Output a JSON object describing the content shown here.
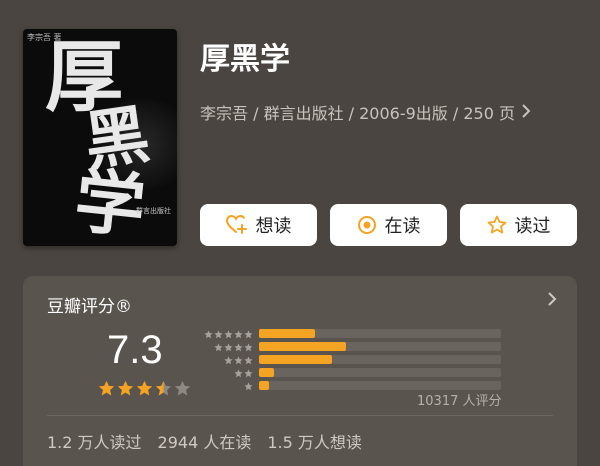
{
  "book": {
    "title": "厚黑学",
    "meta": "李宗吾 / 群言出版社 / 2006-9出版 / 250 页",
    "cover": {
      "glyph1": "厚",
      "glyph2": "黑",
      "glyph3": "学",
      "top_text": "李宗吾 著",
      "seal_text": "群言出版社"
    }
  },
  "actions": {
    "want_label": "想读",
    "reading_label": "在读",
    "read_label": "读过"
  },
  "rating": {
    "title": "豆瓣评分®",
    "score": "7.3",
    "star_value": 3.5,
    "count_text": "10317 人评分",
    "distribution": [
      {
        "stars": 5,
        "fraction": 0.23
      },
      {
        "stars": 4,
        "fraction": 0.36
      },
      {
        "stars": 3,
        "fraction": 0.3
      },
      {
        "stars": 2,
        "fraction": 0.06
      },
      {
        "stars": 1,
        "fraction": 0.04
      }
    ]
  },
  "stats": {
    "read": "1.2 万人读过",
    "reading": "2944 人在读",
    "want": "1.5 万人想读"
  },
  "colors": {
    "accent": "#f4a422",
    "background": "#4a4540",
    "card": "#5a544e"
  },
  "icons": {
    "want": "heart-plus-icon",
    "reading": "target-icon",
    "read": "star-outline-icon",
    "chevron": "chevron-right-icon"
  }
}
